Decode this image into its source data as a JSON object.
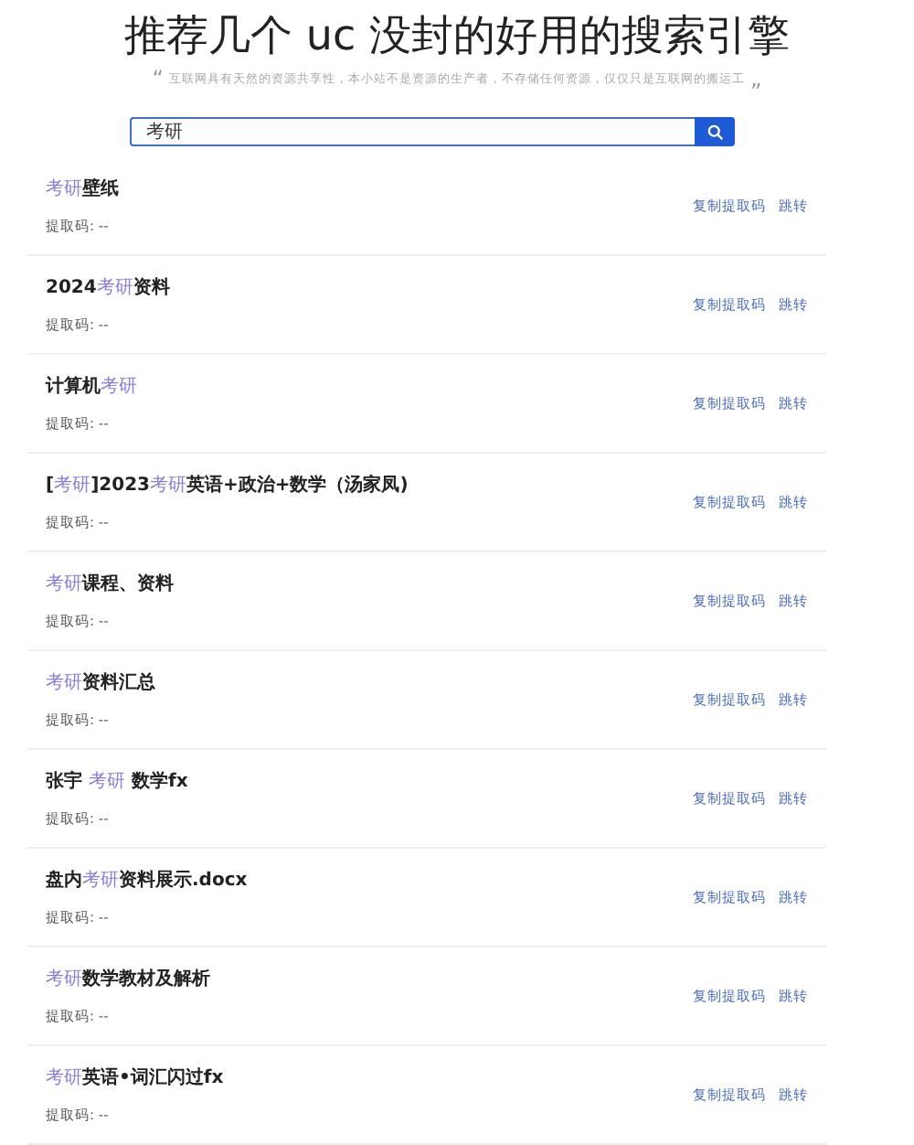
{
  "caption": "推荐几个 uc 没封的好用的搜索引擎",
  "subtitle": {
    "open_quote": "“",
    "text": "互联网具有天然的资源共享性，本小站不是资源的生产者，不存储任何资源，仅仅只是互联网的搬运工",
    "close_quote": "„"
  },
  "search": {
    "value": "考研"
  },
  "results": [
    {
      "title": [
        {
          "text": "考研",
          "highlight": true
        },
        {
          "text": "壁纸",
          "highlight": false
        }
      ],
      "code": "提取码: --",
      "actions": [
        "复制提取码",
        "跳转"
      ]
    },
    {
      "title": [
        {
          "text": "2024",
          "highlight": false
        },
        {
          "text": "考研",
          "highlight": true
        },
        {
          "text": "资料",
          "highlight": false
        }
      ],
      "code": "提取码: --",
      "actions": [
        "复制提取码",
        "跳转"
      ]
    },
    {
      "title": [
        {
          "text": "计算机",
          "highlight": false
        },
        {
          "text": "考研",
          "highlight": true
        }
      ],
      "code": "提取码: --",
      "actions": [
        "复制提取码",
        "跳转"
      ]
    },
    {
      "title": [
        {
          "text": "[",
          "highlight": false
        },
        {
          "text": "考研",
          "highlight": true
        },
        {
          "text": "]2023",
          "highlight": false
        },
        {
          "text": "考研",
          "highlight": true
        },
        {
          "text": "英语+政治+数学（汤家凤)",
          "highlight": false
        }
      ],
      "code": "提取码: --",
      "actions": [
        "复制提取码",
        "跳转"
      ]
    },
    {
      "title": [
        {
          "text": "考研",
          "highlight": true
        },
        {
          "text": "课程、资料",
          "highlight": false
        }
      ],
      "code": "提取码: --",
      "actions": [
        "复制提取码",
        "跳转"
      ]
    },
    {
      "title": [
        {
          "text": "考研",
          "highlight": true
        },
        {
          "text": "资料汇总",
          "highlight": false
        }
      ],
      "code": "提取码: --",
      "actions": [
        "复制提取码",
        "跳转"
      ]
    },
    {
      "title": [
        {
          "text": "张宇 ",
          "highlight": false
        },
        {
          "text": "考研",
          "highlight": true
        },
        {
          "text": " 数学fx",
          "highlight": false
        }
      ],
      "code": "提取码: --",
      "actions": [
        "复制提取码",
        "跳转"
      ]
    },
    {
      "title": [
        {
          "text": "盘内",
          "highlight": false
        },
        {
          "text": "考研",
          "highlight": true
        },
        {
          "text": "资料展示.docx",
          "highlight": false
        }
      ],
      "code": "提取码: --",
      "actions": [
        "复制提取码",
        "跳转"
      ]
    },
    {
      "title": [
        {
          "text": "考研",
          "highlight": true
        },
        {
          "text": "数学教材及解析",
          "highlight": false
        }
      ],
      "code": "提取码: --",
      "actions": [
        "复制提取码",
        "跳转"
      ]
    },
    {
      "title": [
        {
          "text": "考研",
          "highlight": true
        },
        {
          "text": "英语•词汇闪过fx",
          "highlight": false
        }
      ],
      "code": "提取码: --",
      "actions": [
        "复制提取码",
        "跳转"
      ]
    }
  ]
}
